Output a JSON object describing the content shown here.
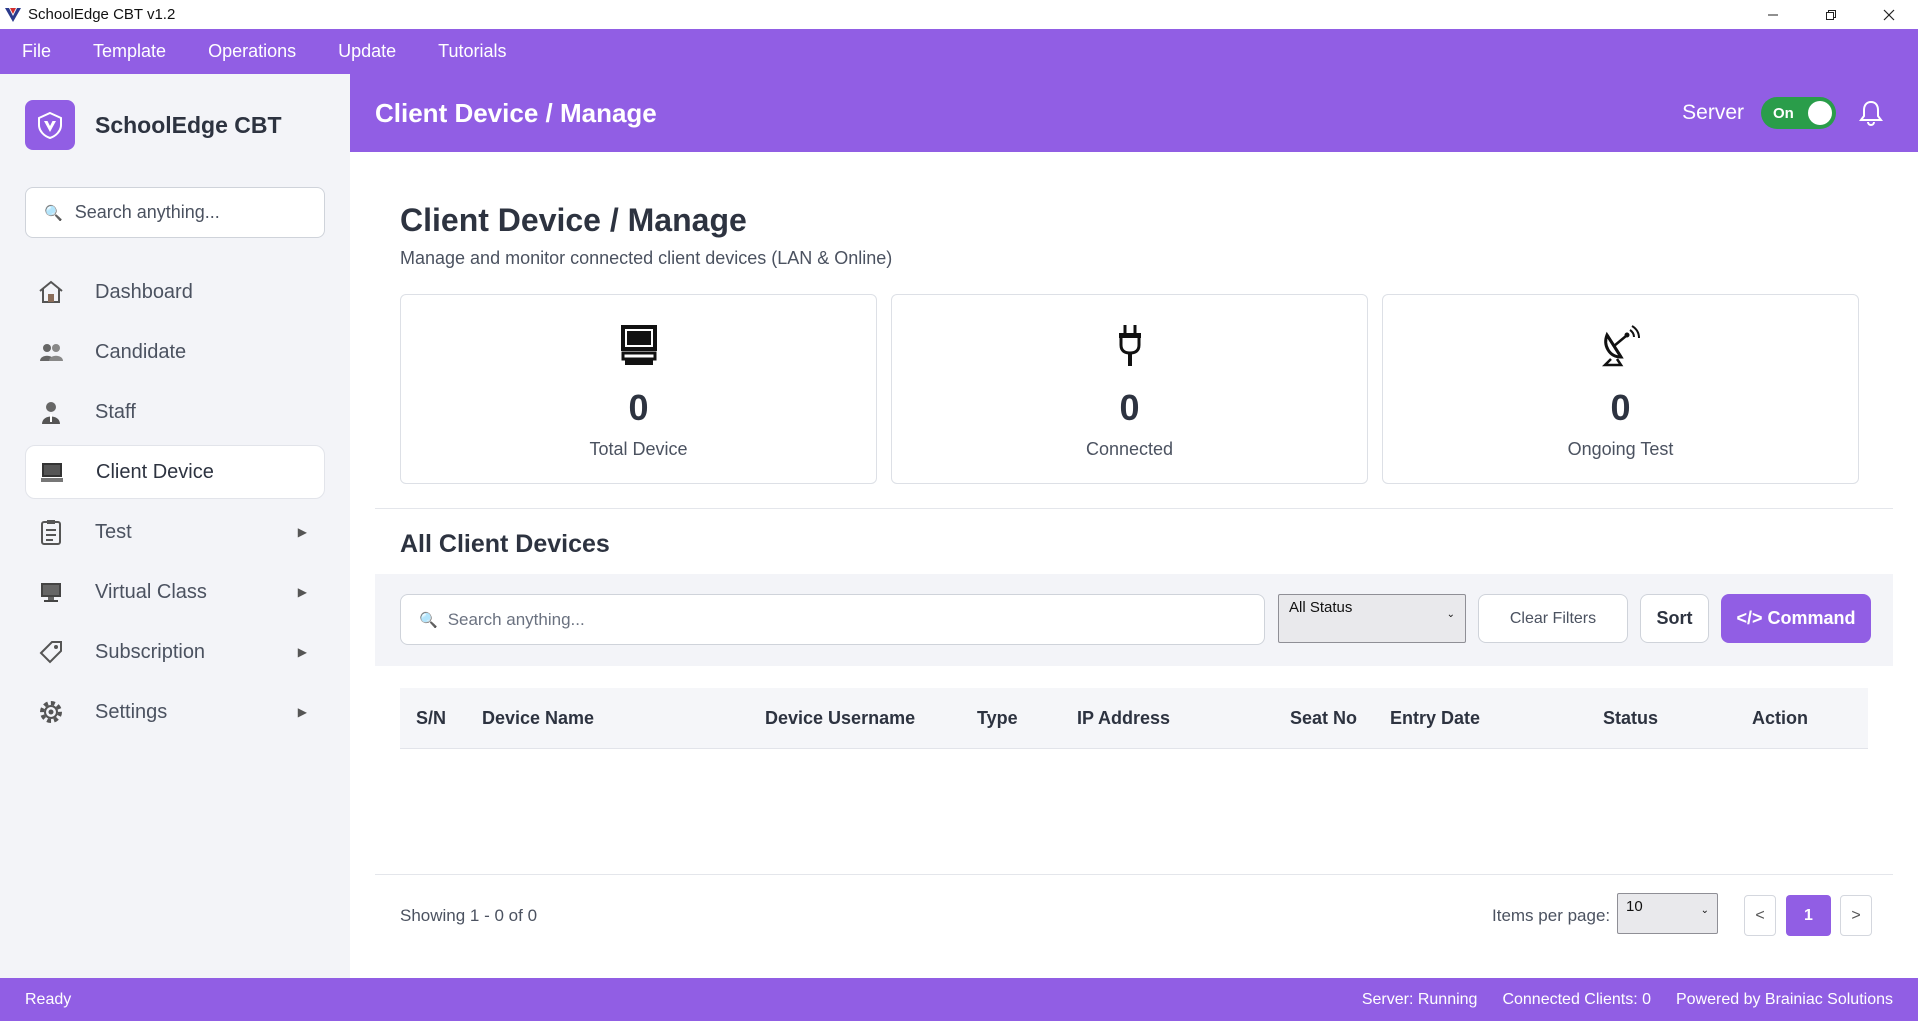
{
  "window": {
    "title": "SchoolEdge CBT v1.2"
  },
  "menu": [
    "File",
    "Template",
    "Operations",
    "Update",
    "Tutorials"
  ],
  "sidebar": {
    "brand": "SchoolEdge CBT",
    "search_placeholder": "Search anything...",
    "items": [
      {
        "label": "Dashboard",
        "icon": "house-icon",
        "active": false,
        "expandable": false
      },
      {
        "label": "Candidate",
        "icon": "users-icon",
        "active": false,
        "expandable": false
      },
      {
        "label": "Staff",
        "icon": "staff-icon",
        "active": false,
        "expandable": false
      },
      {
        "label": "Client Device",
        "icon": "computer-icon",
        "active": true,
        "expandable": false
      },
      {
        "label": "Test",
        "icon": "clipboard-icon",
        "active": false,
        "expandable": true
      },
      {
        "label": "Virtual Class",
        "icon": "monitor-icon",
        "active": false,
        "expandable": true
      },
      {
        "label": "Subscription",
        "icon": "tag-icon",
        "active": false,
        "expandable": true
      },
      {
        "label": "Settings",
        "icon": "gear-icon",
        "active": false,
        "expandable": true
      }
    ]
  },
  "header": {
    "title": "Client Device / Manage",
    "server_label": "Server",
    "toggle_label": "On"
  },
  "page": {
    "title": "Client Device / Manage",
    "subtitle": "Manage and monitor connected client devices (LAN & Online)"
  },
  "stats": [
    {
      "value": "0",
      "label": "Total Device",
      "icon": "computer-icon"
    },
    {
      "value": "0",
      "label": "Connected",
      "icon": "plug-icon"
    },
    {
      "value": "0",
      "label": "Ongoing Test",
      "icon": "satellite-dish-icon"
    }
  ],
  "devices": {
    "title": "All Client Devices",
    "search_placeholder": "Search anything...",
    "status_filter": "All Status",
    "clear_label": "Clear Filters",
    "sort_label": "Sort",
    "command_label": "</> Command",
    "columns": [
      "S/N",
      "Device Name",
      "Device Username",
      "Type",
      "IP Address",
      "Seat No",
      "Entry Date",
      "Status",
      "Action"
    ],
    "rows": []
  },
  "pagination": {
    "showing": "Showing 1  -  0  of  0",
    "items_per_page_label": "Items per page:",
    "items_per_page": "10",
    "prev": "<",
    "current": "1",
    "next": ">"
  },
  "statusbar": {
    "left": "Ready",
    "server": "Server: Running",
    "clients": "Connected Clients: 0",
    "powered": "Powered by Brainiac Solutions"
  },
  "colors": {
    "accent": "#915ee4",
    "toggle_on": "#2a9d4a"
  }
}
